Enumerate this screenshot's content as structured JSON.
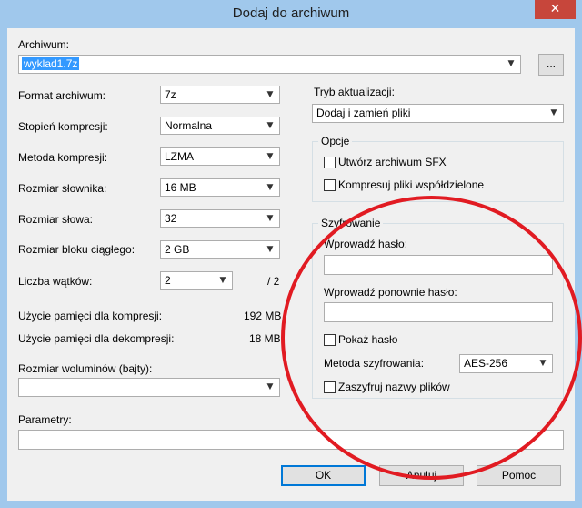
{
  "window": {
    "title": "Dodaj do archiwum",
    "close_glyph": "✕"
  },
  "archive": {
    "label": "Archiwum:",
    "value": "wyklad1.7z",
    "browse": "..."
  },
  "left": {
    "format": {
      "label": "Format archiwum:",
      "value": "7z"
    },
    "level": {
      "label": "Stopień kompresji:",
      "value": "Normalna"
    },
    "method": {
      "label": "Metoda kompresji:",
      "value": "LZMA"
    },
    "dict": {
      "label": "Rozmiar słownika:",
      "value": "16 MB"
    },
    "word": {
      "label": "Rozmiar słowa:",
      "value": "32"
    },
    "solid": {
      "label": "Rozmiar bloku ciągłego:",
      "value": "2 GB"
    },
    "threads": {
      "label": "Liczba wątków:",
      "value": "2",
      "of": "/ 2"
    },
    "mem_comp": {
      "label": "Użycie pamięci dla kompresji:",
      "value": "192 MB"
    },
    "mem_decomp": {
      "label": "Użycie pamięci dla dekompresji:",
      "value": "18 MB"
    },
    "volumes": {
      "label": "Rozmiar woluminów (bajty):",
      "value": ""
    }
  },
  "params": {
    "label": "Parametry:",
    "value": ""
  },
  "right": {
    "update": {
      "label": "Tryb aktualizacji:",
      "value": "Dodaj i zamień pliki"
    },
    "options": {
      "title": "Opcje",
      "sfx": "Utwórz archiwum SFX",
      "shared": "Kompresuj pliki współdzielone"
    },
    "encryption": {
      "title": "Szyfrowanie",
      "password_label": "Wprowadź hasło:",
      "password_value": "",
      "repeat_label": "Wprowadź ponownie hasło:",
      "repeat_value": "",
      "show_password": "Pokaż hasło",
      "method_label": "Metoda szyfrowania:",
      "method_value": "AES-256",
      "encrypt_names": "Zaszyfruj nazwy plików"
    }
  },
  "buttons": {
    "ok": "OK",
    "cancel": "Anuluj",
    "help": "Pomoc"
  },
  "colors": {
    "annotation": "#e11b22",
    "selection": "#3399ff"
  }
}
